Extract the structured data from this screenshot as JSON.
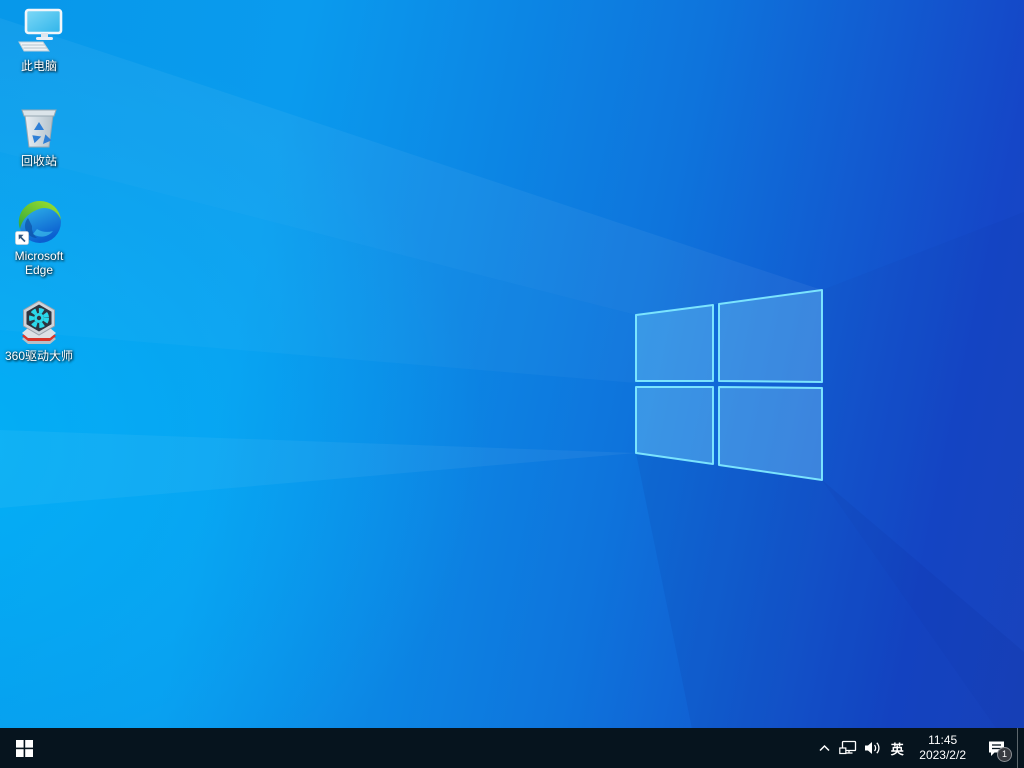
{
  "wallpaper": {
    "name": "windows-10-light-hero",
    "colors": {
      "left_glow": "#00a2f3",
      "top_left": "#0894e9",
      "top_right": "#1140c8",
      "bottom_right": "#1a45be",
      "logo_stroke": "#7fe9ff"
    }
  },
  "desktop": {
    "icons": [
      {
        "label": "此电脑",
        "icon": "this-pc-icon"
      },
      {
        "label": "回收站",
        "icon": "recycle-bin-icon"
      },
      {
        "label": "Microsoft Edge",
        "icon": "edge-icon",
        "shortcut_overlay": "shortcut-arrow-icon"
      },
      {
        "label": "360驱动大师",
        "icon": "360-driver-master-icon"
      }
    ]
  },
  "taskbar": {
    "background": "#06141e",
    "start_button": {
      "icon": "windows-start-icon"
    },
    "tray": {
      "hidden_icons": {
        "icon": "chevron-up-icon"
      },
      "network": {
        "icon": "network-ethernet-icon"
      },
      "volume": {
        "icon": "volume-icon"
      },
      "ime_label": "英",
      "clock": {
        "time": "11:45",
        "date": "2023/2/2"
      },
      "action_center": {
        "icon": "action-center-icon",
        "badge": "1"
      }
    }
  }
}
